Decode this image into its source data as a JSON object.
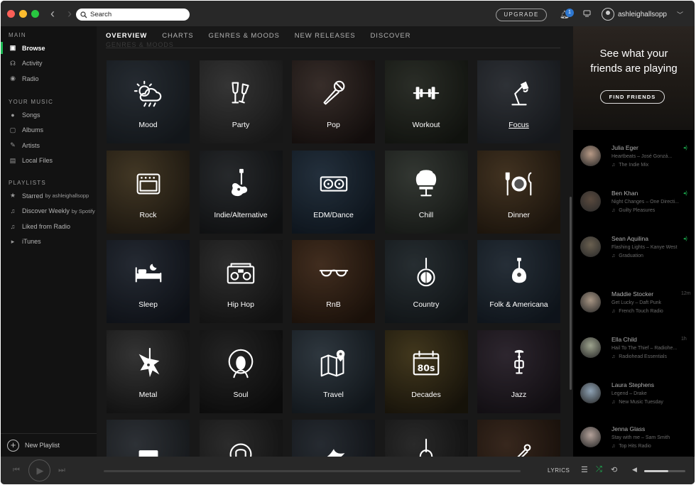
{
  "titlebar": {
    "search_placeholder": "Search",
    "upgrade_label": "UPGRADE",
    "notification_count": "1",
    "username": "ashleighallsopp"
  },
  "sidebar": {
    "sections": [
      {
        "title": "MAIN",
        "items": [
          {
            "label": "Browse",
            "icon": "browse-icon",
            "active": true
          },
          {
            "label": "Activity",
            "icon": "activity-icon"
          },
          {
            "label": "Radio",
            "icon": "radio-icon"
          }
        ]
      },
      {
        "title": "YOUR MUSIC",
        "items": [
          {
            "label": "Songs",
            "icon": "songs-icon"
          },
          {
            "label": "Albums",
            "icon": "albums-icon"
          },
          {
            "label": "Artists",
            "icon": "artists-icon"
          },
          {
            "label": "Local Files",
            "icon": "local-files-icon"
          }
        ]
      },
      {
        "title": "PLAYLISTS",
        "items": [
          {
            "label": "Starred",
            "by": "by ashleighallsopp",
            "icon": "star-icon"
          },
          {
            "label": "Discover Weekly",
            "by": "by Spotify",
            "icon": "note-icon"
          },
          {
            "label": "Liked from Radio",
            "icon": "note-icon"
          },
          {
            "label": "iTunes",
            "icon": "expand-arrow-icon"
          }
        ]
      }
    ],
    "new_playlist_label": "New Playlist"
  },
  "main": {
    "tabs": [
      {
        "label": "OVERVIEW",
        "active": true
      },
      {
        "label": "CHARTS"
      },
      {
        "label": "GENRES & MOODS"
      },
      {
        "label": "NEW RELEASES"
      },
      {
        "label": "DISCOVER"
      }
    ],
    "section_ghost_title": "GENRES & MOODS",
    "tiles": [
      {
        "label": "Mood",
        "icon": "weather-icon",
        "colors": [
          "#3d4650",
          "#1e242a"
        ]
      },
      {
        "label": "Party",
        "icon": "champagne-glasses-icon",
        "colors": [
          "#565656",
          "#262626"
        ]
      },
      {
        "label": "Pop",
        "icon": "microphone-icon",
        "colors": [
          "#5a4a44",
          "#1e1614"
        ]
      },
      {
        "label": "Workout",
        "icon": "dumbbell-icon",
        "colors": [
          "#454a40",
          "#1b1e18"
        ]
      },
      {
        "label": "Focus",
        "icon": "desk-lamp-icon",
        "colors": [
          "#4b5058",
          "#22262c"
        ],
        "underline": true
      },
      {
        "label": "Rock",
        "icon": "amplifier-icon",
        "colors": [
          "#6b5a3c",
          "#2b2318"
        ]
      },
      {
        "label": "Indie/Alternative",
        "icon": "electric-guitar-icon",
        "colors": [
          "#3f4347",
          "#17191b"
        ]
      },
      {
        "label": "EDM/Dance",
        "icon": "turntable-icon",
        "colors": [
          "#3a4e62",
          "#15202c"
        ]
      },
      {
        "label": "Chill",
        "icon": "egg-chair-icon",
        "colors": [
          "#535a52",
          "#222622"
        ]
      },
      {
        "label": "Dinner",
        "icon": "plate-cutlery-icon",
        "colors": [
          "#6a5236",
          "#2a1f13"
        ]
      },
      {
        "label": "Sleep",
        "icon": "bed-icon",
        "colors": [
          "#3c4452",
          "#161b24"
        ]
      },
      {
        "label": "Hip Hop",
        "icon": "boombox-icon",
        "colors": [
          "#4a4a4a",
          "#1c1c1c"
        ]
      },
      {
        "label": "RnB",
        "icon": "sunglasses-icon",
        "colors": [
          "#6a4a33",
          "#2a1b10"
        ]
      },
      {
        "label": "Country",
        "icon": "banjo-icon",
        "colors": [
          "#3f4a50",
          "#1a2024"
        ]
      },
      {
        "label": "Folk & Americana",
        "icon": "mandolin-icon",
        "colors": [
          "#3e4c5a",
          "#17202a"
        ]
      },
      {
        "label": "Metal",
        "icon": "metal-guitar-icon",
        "colors": [
          "#545454",
          "#1a1a1a"
        ]
      },
      {
        "label": "Soul",
        "icon": "afro-portrait-icon",
        "colors": [
          "#3a3a3a",
          "#121212"
        ]
      },
      {
        "label": "Travel",
        "icon": "map-pin-icon",
        "colors": [
          "#4c5a66",
          "#1b232a"
        ]
      },
      {
        "label": "Decades",
        "icon": "calendar-80s-icon",
        "colors": [
          "#6a5a30",
          "#231d10"
        ]
      },
      {
        "label": "Jazz",
        "icon": "trumpet-icon",
        "colors": [
          "#4a3e4c",
          "#1b161c"
        ]
      },
      {
        "label": "",
        "icon": "radio-box-icon",
        "colors": [
          "#4a5058",
          "#1e2226"
        ]
      },
      {
        "label": "",
        "icon": "lion-icon",
        "colors": [
          "#474747",
          "#1a1a1a"
        ]
      },
      {
        "label": "",
        "icon": "bird-icon",
        "colors": [
          "#3e4650",
          "#181c22"
        ]
      },
      {
        "label": "",
        "icon": "acoustic-guitar-icon",
        "colors": [
          "#444444",
          "#181818"
        ]
      },
      {
        "label": "",
        "icon": "safety-pin-icon",
        "colors": [
          "#5a4030",
          "#22170f"
        ]
      }
    ]
  },
  "friends": {
    "title": "See what your friends are playing",
    "button_label": "FIND FRIENDS",
    "list": [
      {
        "name": "Julia Eger",
        "track": "Heartbeats – José Gonzá...",
        "context": "The Indie Mix",
        "time": "",
        "playing": true,
        "avatar_color": "#b89a86"
      },
      {
        "name": "Ben Khan",
        "track": "Night Changes – One Directi...",
        "context": "Guilty Pleasures",
        "time": "",
        "playing": true,
        "avatar_color": "#5a4a3e"
      },
      {
        "name": "Sean Aquilina",
        "track": "Flashing Lights – Kanye West",
        "context": "Graduation",
        "time": "",
        "playing": true,
        "avatar_color": "#6a6050"
      },
      {
        "name": "Maddie Stocker",
        "track": "Get Lucky – Daft Punk",
        "context": "French Touch Radio",
        "time": "12m",
        "playing": false,
        "avatar_color": "#a89684"
      },
      {
        "name": "Ella Child",
        "track": "Hail To The Thief – Radiohe...",
        "context": "Radiohead Essentials",
        "time": "1h",
        "playing": false,
        "avatar_color": "#9ea48e"
      },
      {
        "name": "Laura Stephens",
        "track": "Legend – Drake",
        "context": "New Music Tuesday",
        "time": "",
        "playing": false,
        "avatar_color": "#8ea2b4"
      },
      {
        "name": "Jenna Glass",
        "track": "Stay with me – Sam Smith",
        "context": "Top Hits Radio",
        "time": "",
        "playing": false,
        "avatar_color": "#b4a29a"
      }
    ]
  },
  "player": {
    "lyrics_label": "LYRICS",
    "volume": 0.58
  }
}
